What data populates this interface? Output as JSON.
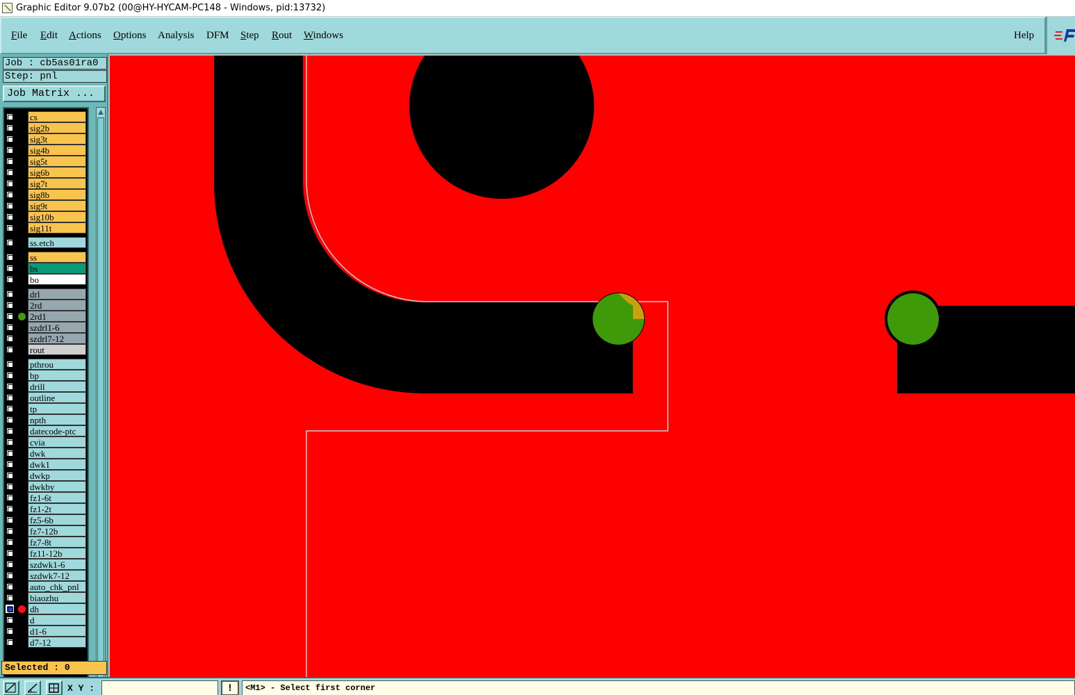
{
  "window": {
    "title": "Graphic Editor 9.07b2 (00@HY-HYCAM-PC148 - Windows, pid:13732)"
  },
  "menu": {
    "items": [
      {
        "label": "File",
        "underline": "F",
        "rest": "ile"
      },
      {
        "label": "Edit",
        "underline": "E",
        "rest": "dit"
      },
      {
        "label": "Actions",
        "underline": "A",
        "rest": "ctions"
      },
      {
        "label": "Options",
        "underline": "O",
        "rest": "ptions"
      },
      {
        "label": "Analysis",
        "underline": "",
        "rest": "Analysis"
      },
      {
        "label": "DFM",
        "underline": "",
        "rest": "DFM"
      },
      {
        "label": "Step",
        "underline": "S",
        "rest": "tep"
      },
      {
        "label": "Rout",
        "underline": "R",
        "rest": "out"
      },
      {
        "label": "Windows",
        "underline": "W",
        "rest": "indows"
      }
    ],
    "help": "Help"
  },
  "job": {
    "job_label": "Job : cb5as01ra0",
    "step_label": "Step: pnl",
    "job_matrix_button": "Job Matrix ..."
  },
  "layers": [
    {
      "name": "cs",
      "color": "yellow",
      "dot": ""
    },
    {
      "name": "sig2b",
      "color": "yellow",
      "dot": ""
    },
    {
      "name": "sig3t",
      "color": "yellow",
      "dot": ""
    },
    {
      "name": "sig4b",
      "color": "yellow",
      "dot": ""
    },
    {
      "name": "sig5t",
      "color": "yellow",
      "dot": ""
    },
    {
      "name": "sig6b",
      "color": "yellow",
      "dot": ""
    },
    {
      "name": "sig7t",
      "color": "yellow",
      "dot": ""
    },
    {
      "name": "sig8b",
      "color": "yellow",
      "dot": ""
    },
    {
      "name": "sig9t",
      "color": "yellow",
      "dot": ""
    },
    {
      "name": "sig10b",
      "color": "yellow",
      "dot": ""
    },
    {
      "name": "sig11t",
      "color": "yellow",
      "dot": ""
    },
    {
      "name": "ss.etch",
      "color": "teal",
      "dot": "",
      "gap": true
    },
    {
      "name": "ss",
      "color": "yellow",
      "dot": "",
      "gap": true
    },
    {
      "name": "bs",
      "color": "green",
      "dot": ""
    },
    {
      "name": "bo",
      "color": "white",
      "dot": ""
    },
    {
      "name": "drl",
      "color": "gray",
      "dot": "",
      "gap": true
    },
    {
      "name": "2rd",
      "color": "gray",
      "dot": ""
    },
    {
      "name": "2rd1",
      "color": "gray",
      "dot": "#3f9a1a"
    },
    {
      "name": "szdrl1-6",
      "color": "gray",
      "dot": ""
    },
    {
      "name": "szdrl7-12",
      "color": "gray",
      "dot": ""
    },
    {
      "name": "rout",
      "color": "light",
      "dot": ""
    },
    {
      "name": "pthrou",
      "color": "teal",
      "dot": "",
      "gap": true
    },
    {
      "name": "bp",
      "color": "teal",
      "dot": ""
    },
    {
      "name": "drill",
      "color": "teal",
      "dot": ""
    },
    {
      "name": "outline",
      "color": "teal",
      "dot": ""
    },
    {
      "name": "tp",
      "color": "teal",
      "dot": ""
    },
    {
      "name": "npth",
      "color": "teal",
      "dot": ""
    },
    {
      "name": "datecode-ptc",
      "color": "teal",
      "dot": ""
    },
    {
      "name": "cvia",
      "color": "teal",
      "dot": ""
    },
    {
      "name": "dwk",
      "color": "teal",
      "dot": ""
    },
    {
      "name": "dwk1",
      "color": "teal",
      "dot": ""
    },
    {
      "name": "dwkp",
      "color": "teal",
      "dot": ""
    },
    {
      "name": "dwkby",
      "color": "teal",
      "dot": ""
    },
    {
      "name": "fz1-6t",
      "color": "teal",
      "dot": ""
    },
    {
      "name": "fz1-2t",
      "color": "teal",
      "dot": ""
    },
    {
      "name": "fz5-6b",
      "color": "teal",
      "dot": ""
    },
    {
      "name": "fz7-12b",
      "color": "teal",
      "dot": ""
    },
    {
      "name": "fz7-8t",
      "color": "teal",
      "dot": ""
    },
    {
      "name": "fz11-12b",
      "color": "teal",
      "dot": ""
    },
    {
      "name": "szdwk1-6",
      "color": "teal",
      "dot": ""
    },
    {
      "name": "szdwk7-12",
      "color": "teal",
      "dot": ""
    },
    {
      "name": "auto_chk_pnl",
      "color": "teal",
      "dot": ""
    },
    {
      "name": "biaozhu",
      "color": "teal",
      "dot": ""
    },
    {
      "name": "dh",
      "color": "teal",
      "dot": "#ff1010",
      "active": true
    },
    {
      "name": "d",
      "color": "teal",
      "dot": ""
    },
    {
      "name": "d1-6",
      "color": "teal",
      "dot": ""
    },
    {
      "name": "d7-12",
      "color": "teal",
      "dot": ""
    }
  ],
  "status": {
    "selected": "Selected : 0",
    "xy_label": "X Y :",
    "xy_value": "",
    "warn": "!",
    "prompt": "<M1> - Select first corner"
  },
  "colors": {
    "canvas_bg": "#ff0000",
    "copper": "#000000",
    "pad": "#3f9a0a",
    "pad_overlap": "#c8a010",
    "outline": "#b0c8d0",
    "menu_bg": "#9fd9db"
  },
  "icons": {
    "app": "graphic-editor-icon",
    "logo": "frontline-logo"
  }
}
